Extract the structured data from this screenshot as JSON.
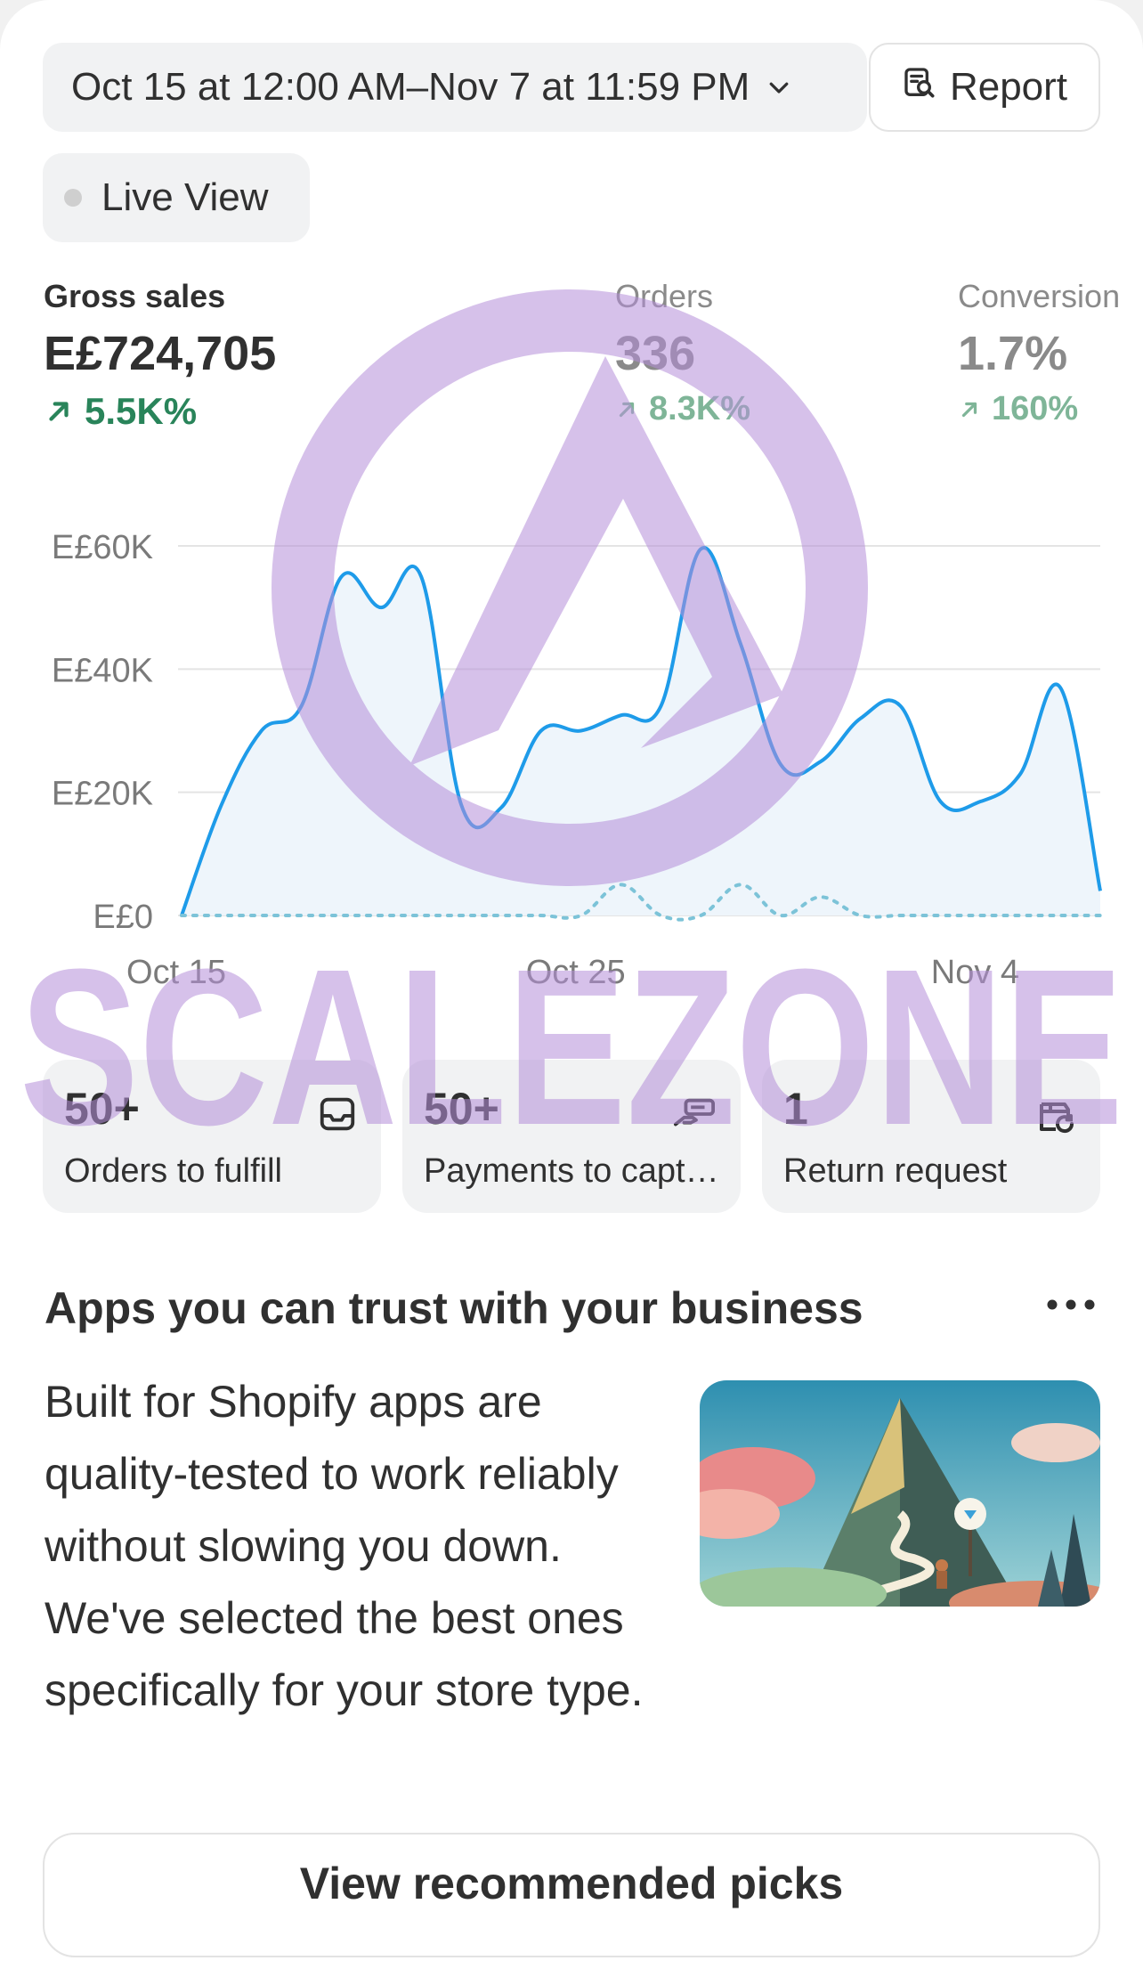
{
  "header": {
    "date_range": "Oct 15 at 12:00 AM–Nov 7 at 11:59 PM",
    "report_label": "Report",
    "live_view_label": "Live View"
  },
  "metrics": [
    {
      "label": "Gross sales",
      "value": "E£724,705",
      "change": "5.5K%"
    },
    {
      "label": "Orders",
      "value": "336",
      "change": "8.3K%"
    },
    {
      "label": "Conversion",
      "value": "1.7%",
      "change": "160%"
    }
  ],
  "chart_data": {
    "type": "line",
    "xlabel": "",
    "ylabel": "",
    "y_tick_labels": [
      "E£60K",
      "E£40K",
      "E£20K",
      "E£0"
    ],
    "y_ticks": [
      60000,
      40000,
      20000,
      0
    ],
    "ylim": [
      0,
      60000
    ],
    "x_tick_labels": [
      "Oct 15",
      "Oct 25",
      "Nov 4"
    ],
    "x_tick_days": [
      0,
      10,
      20
    ],
    "xlim": [
      0,
      23
    ],
    "grid": true,
    "series": [
      {
        "style": "solid",
        "color": "#1e9be9",
        "x": [
          0,
          1,
          2,
          3,
          4,
          5,
          6,
          7,
          8,
          9,
          10,
          11,
          12,
          13,
          14,
          15,
          16,
          17,
          18,
          19,
          20,
          21,
          22,
          23
        ],
        "values": [
          0,
          18000,
          30000,
          34000,
          55000,
          50000,
          55000,
          18000,
          17500,
          30000,
          30000,
          32500,
          34000,
          59500,
          44000,
          24500,
          25000,
          32000,
          34000,
          18500,
          18500,
          23000,
          37000,
          4000
        ]
      },
      {
        "style": "dotted",
        "color": "#7cc3d8",
        "x": [
          0,
          1,
          2,
          3,
          4,
          5,
          6,
          7,
          8,
          9,
          10,
          11,
          12,
          13,
          14,
          15,
          16,
          17,
          18,
          19,
          20,
          21,
          22,
          23
        ],
        "values": [
          0,
          0,
          0,
          0,
          0,
          0,
          0,
          0,
          0,
          0,
          0,
          5000,
          0,
          0,
          5000,
          0,
          3000,
          0,
          0,
          0,
          0,
          0,
          0,
          0
        ]
      }
    ]
  },
  "tasks": [
    {
      "count": "50+",
      "label": "Orders to fulfill",
      "icon": "inbox-icon"
    },
    {
      "count": "50+",
      "label": "Payments to capture",
      "icon": "payment-hand-icon"
    },
    {
      "count": "1",
      "label": "Return request",
      "icon": "return-icon"
    }
  ],
  "promo": {
    "title": "Apps you can trust with your business",
    "body": "Built for Shopify apps are quality-tested to work reliably without slowing you down. We've selected the best ones specifically for your store type.",
    "cta": "View recommended picks"
  },
  "watermark": {
    "text": "SCALEZONE"
  }
}
